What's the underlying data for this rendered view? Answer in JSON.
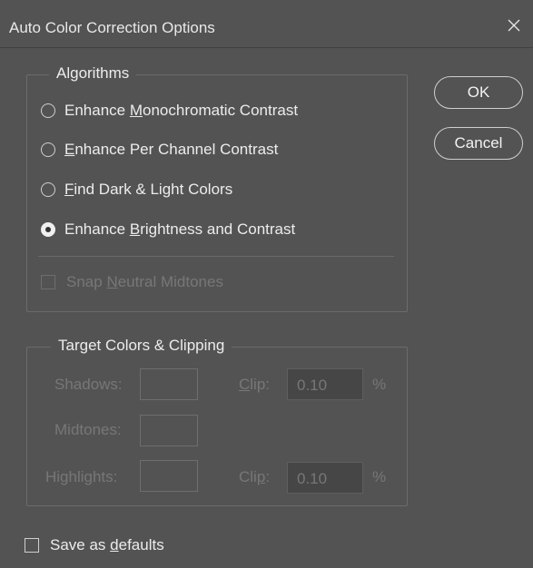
{
  "dialog": {
    "title": "Auto Color Correction Options",
    "close_icon": "close-icon"
  },
  "algorithms": {
    "legend": "Algorithms",
    "options": [
      {
        "pre": "Enhance ",
        "key": "M",
        "post": "onochromatic Contrast",
        "selected": false
      },
      {
        "pre": "",
        "key": "E",
        "post": "nhance Per Channel Contrast",
        "selected": false
      },
      {
        "pre": "",
        "key": "F",
        "post": "ind Dark & Light Colors",
        "selected": false
      },
      {
        "pre": "Enhance ",
        "key": "B",
        "post": "rightness and Contrast",
        "selected": true
      }
    ],
    "snap": {
      "pre": "Snap ",
      "key": "N",
      "post": "eutral Midtones",
      "checked": false,
      "enabled": false
    }
  },
  "target": {
    "legend": "Target Colors & Clipping",
    "shadows_label": "Shadows:",
    "midtones_label": "Midtones:",
    "highlights_label": "Highlights:",
    "clip1": {
      "pre": "",
      "key": "C",
      "post": "lip:",
      "value": "0.10",
      "unit": "%"
    },
    "clip2": {
      "pre": "Cli",
      "key": "p",
      "post": ":",
      "value": "0.10",
      "unit": "%"
    }
  },
  "buttons": {
    "ok": "OK",
    "cancel": "Cancel"
  },
  "save_defaults": {
    "pre": "Save as ",
    "key": "d",
    "post": "efaults",
    "checked": false
  },
  "colors": {
    "background": "#535353",
    "text": "#ececec",
    "disabled_text": "#777777",
    "border": "#6b6b6b"
  }
}
